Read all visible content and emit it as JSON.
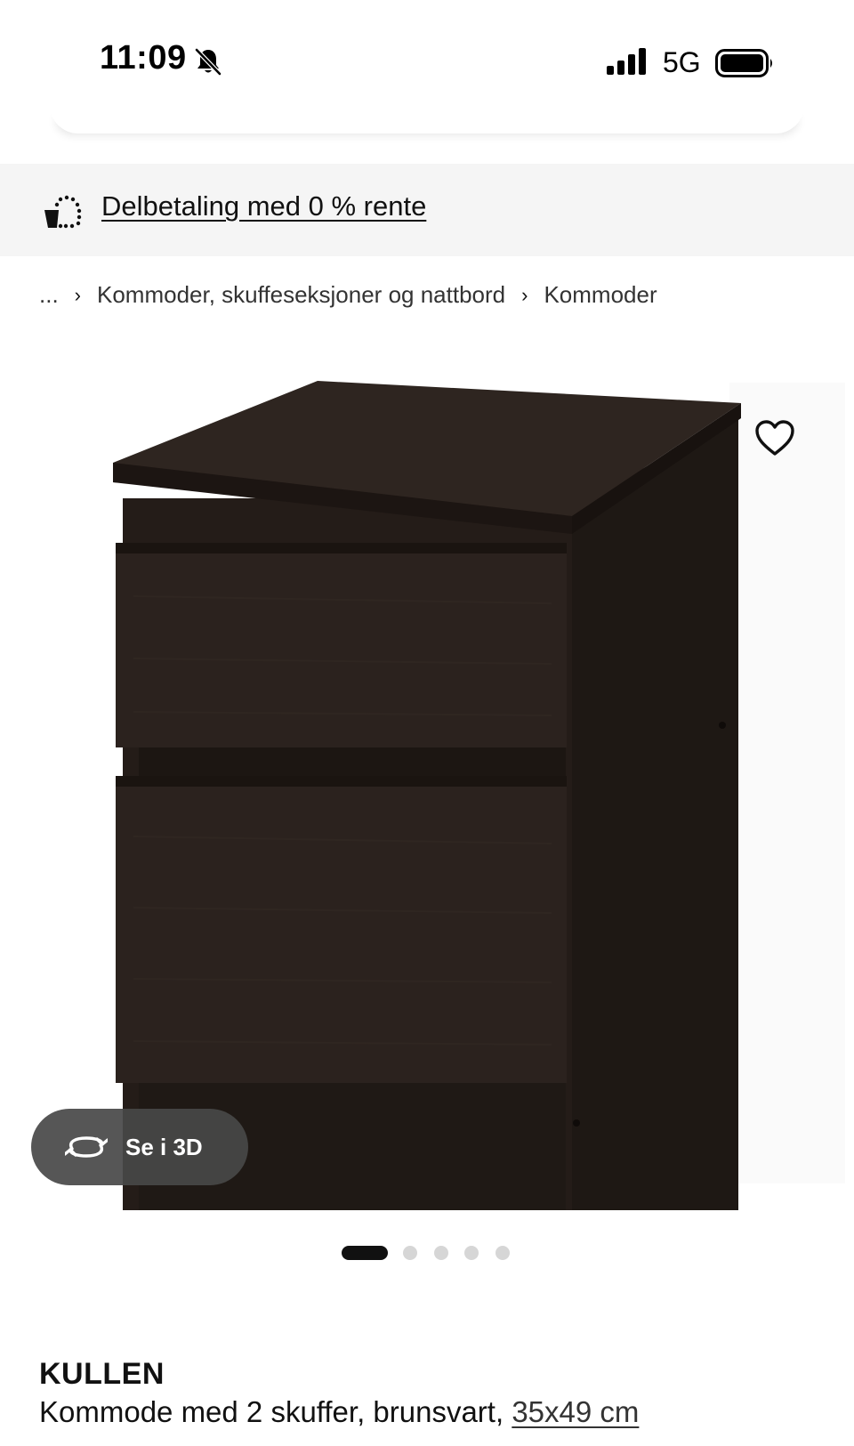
{
  "status_bar": {
    "time": "11:09",
    "network": "5G",
    "icons": [
      "bell-slash-icon",
      "cellular-signal-icon",
      "battery-icon"
    ]
  },
  "promo": {
    "icon": "installment-payment-icon",
    "link_text": "Delbetaling med 0 % rente"
  },
  "breadcrumb": {
    "items": [
      "...",
      "Kommoder, skuffeseksjoner og nattbord",
      "Kommoder"
    ],
    "separator_icon": "chevron-right-icon"
  },
  "gallery": {
    "image": "chest-of-drawers-image",
    "favorite_icon": "heart-outline-icon",
    "view_3d_label": "Se i 3D",
    "view_3d_icon": "rotate-3d-icon",
    "page_count": 5,
    "active_page": 1
  },
  "product": {
    "name": "KULLEN",
    "description": "Kommode med 2 skuffer, brunsvart,",
    "size_link": "35x49 cm"
  },
  "colors": {
    "furniture": "#2a221e",
    "banner_bg": "#f5f5f5",
    "active_dot": "#111111",
    "inactive_dot": "#d6d6d6",
    "button_3d_bg": "#484848"
  }
}
